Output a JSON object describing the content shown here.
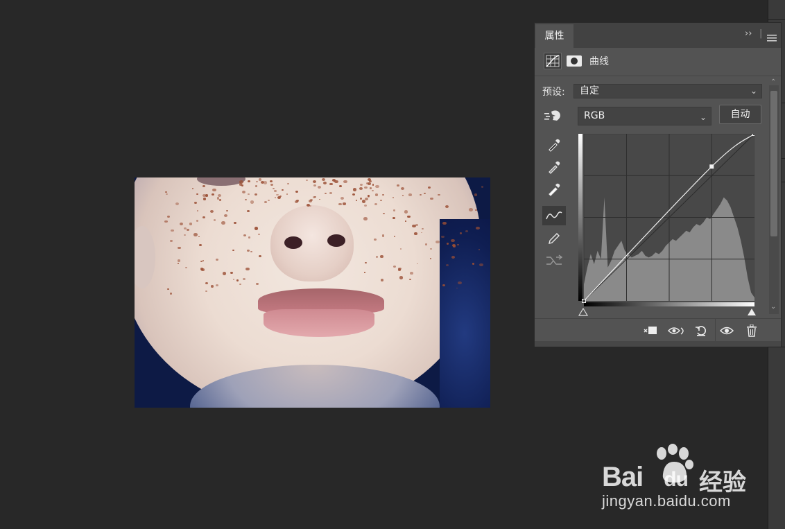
{
  "panel": {
    "tab_label": "属性",
    "collapse_glyph": "››",
    "adjustment_type": "曲线",
    "preset_label": "预设:",
    "preset_value": "自定",
    "channel_value": "RGB",
    "auto_button": "自动"
  },
  "curve": {
    "points": [
      [
        0,
        0
      ],
      [
        191,
        205
      ],
      [
        255,
        255
      ]
    ],
    "input_range": [
      0,
      255
    ],
    "output_range": [
      0,
      255
    ]
  },
  "watermark": {
    "brand_bai": "Bai",
    "brand_du": "du",
    "brand_cn": "经验",
    "url": "jingyan.baidu.com"
  },
  "icons": {
    "panel_menu": "panel-menu-icon",
    "curves_adjustment": "curves-adjustment-icon",
    "layer_mask": "layer-mask-icon",
    "on_image_adjust": "targeted-adjustment-hand-icon",
    "black_point": "eyedropper-black-icon",
    "gray_point": "eyedropper-gray-icon",
    "white_point": "eyedropper-white-icon",
    "edit_points": "curve-points-icon",
    "draw_curve": "pencil-icon",
    "smooth": "smooth-curve-icon",
    "clip_to_layer": "clip-to-layer-icon",
    "view_previous": "view-previous-state-icon",
    "reset": "reset-icon",
    "visibility": "eye-icon",
    "delete": "trash-icon"
  },
  "colors": {
    "workspace": "#282828",
    "panel": "#535353",
    "panel_tabbar": "#424242",
    "histogram": "#8a8a8a"
  }
}
